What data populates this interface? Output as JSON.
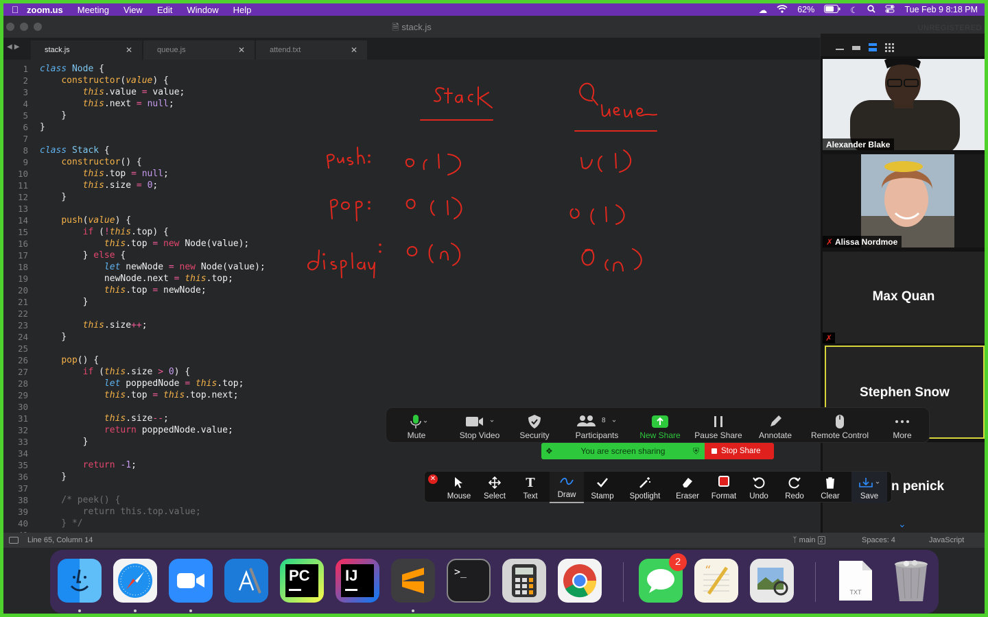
{
  "menubar": {
    "app": "zoom.us",
    "items": [
      "Meeting",
      "View",
      "Edit",
      "Window",
      "Help"
    ],
    "battery": "62%",
    "datetime": "Tue Feb 9  8:18 PM"
  },
  "window": {
    "title": "stack.js",
    "unregistered": "UNREGISTERED"
  },
  "tabs": [
    {
      "label": "stack.js"
    },
    {
      "label": "queue.js"
    },
    {
      "label": "attend.txt"
    }
  ],
  "statusbar": {
    "position": "Line 65, Column 14",
    "branch": "main",
    "branch_badge": "2",
    "spaces": "Spaces: 4",
    "syntax": "JavaScript"
  },
  "participants": [
    {
      "name": "Alexander Blake",
      "video": true,
      "muted": false
    },
    {
      "name": "Alissa Nordmoe",
      "video": true,
      "muted": true
    },
    {
      "name": "Max Quan",
      "video": false,
      "muted": true
    },
    {
      "name": "Stephen Snow",
      "video": false,
      "muted": false,
      "active_speaker": true
    },
    {
      "name": "n penick",
      "video": false,
      "muted": true
    }
  ],
  "zoom_controls": {
    "mute": "Mute",
    "stop_video": "Stop Video",
    "security": "Security",
    "participants": "Participants",
    "participant_count": "8",
    "new_share": "New Share",
    "pause_share": "Pause Share",
    "annotate": "Annotate",
    "remote_control": "Remote Control",
    "more": "More"
  },
  "share_bar": {
    "status": "You are screen sharing",
    "stop": "Stop Share"
  },
  "annotate_tools": {
    "mouse": "Mouse",
    "select": "Select",
    "text": "Text",
    "draw": "Draw",
    "stamp": "Stamp",
    "spotlight": "Spotlight",
    "eraser": "Eraser",
    "format": "Format",
    "undo": "Undo",
    "redo": "Redo",
    "clear": "Clear",
    "save": "Save"
  },
  "handwriting": {
    "title_left": "Stack",
    "title_right": "Queue",
    "row_push": "push:",
    "row_pop": "pop:",
    "row_display": "display:",
    "stack_push": "O(1)",
    "stack_pop": "O(1)",
    "stack_display": "O(n)",
    "queue_push": "O(1)",
    "queue_pop": "O(1)",
    "queue_display": "O(n)"
  },
  "dock": {
    "messages_badge": "2",
    "txt_label": "TXT",
    "apps": [
      "finder-icon",
      "safari-icon",
      "zoom-icon",
      "xcode-icon",
      "pycharm-icon",
      "intellij-icon",
      "sublime-icon",
      "terminal-icon",
      "calculator-icon",
      "chrome-icon",
      "messages-icon",
      "textedit-icon",
      "preview-icon",
      "txt-file-icon",
      "trash-icon"
    ]
  },
  "code_lines": [
    "class Node {",
    "    constructor(value) {",
    "        this.value = value;",
    "        this.next = null;",
    "    }",
    "}",
    "",
    "class Stack {",
    "    constructor() {",
    "        this.top = null;",
    "        this.size = 0;",
    "    }",
    "",
    "    push(value) {",
    "        if (!this.top) {",
    "            this.top = new Node(value);",
    "        } else {",
    "            let newNode = new Node(value);",
    "            newNode.next = this.top;",
    "            this.top = newNode;",
    "        }",
    "",
    "        this.size++;",
    "    }",
    "",
    "    pop() {",
    "        if (this.size > 0) {",
    "            let poppedNode = this.top;",
    "            this.top = this.top.next;",
    "",
    "            this.size--;",
    "            return poppedNode.value;",
    "        }",
    "",
    "        return -1;",
    "    }",
    "",
    "    /* peek() {",
    "        return this.top.value;",
    "    } */",
    ""
  ]
}
